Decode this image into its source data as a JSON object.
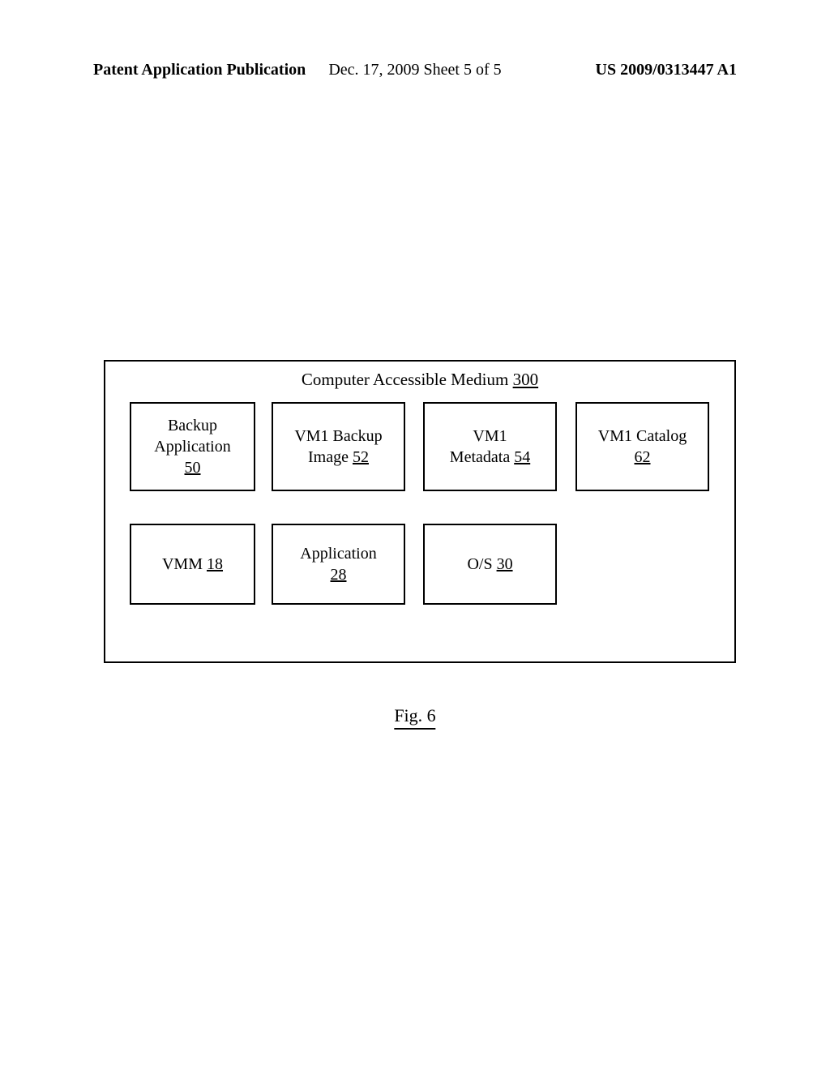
{
  "header": {
    "left": "Patent Application Publication",
    "center": "Dec. 17, 2009  Sheet 5 of 5",
    "right": "US 2009/0313447 A1"
  },
  "diagram": {
    "title_text": "Computer Accessible Medium ",
    "title_ref": "300",
    "boxes": {
      "box1": {
        "line1": "Backup",
        "line2": "Application",
        "ref": "50"
      },
      "box2": {
        "line1": "VM1 Backup",
        "line2_text": "Image ",
        "line2_ref": "52"
      },
      "box3": {
        "line1": "VM1",
        "line2_text": "Metadata ",
        "line2_ref": "54"
      },
      "box4": {
        "line1": "VM1 Catalog",
        "ref": "62"
      },
      "box5": {
        "line1_text": "VMM ",
        "line1_ref": "18"
      },
      "box6": {
        "line1": "Application",
        "ref": "28"
      },
      "box7": {
        "line1_text": "O/S ",
        "line1_ref": "30"
      }
    }
  },
  "figure_caption": "Fig. 6"
}
